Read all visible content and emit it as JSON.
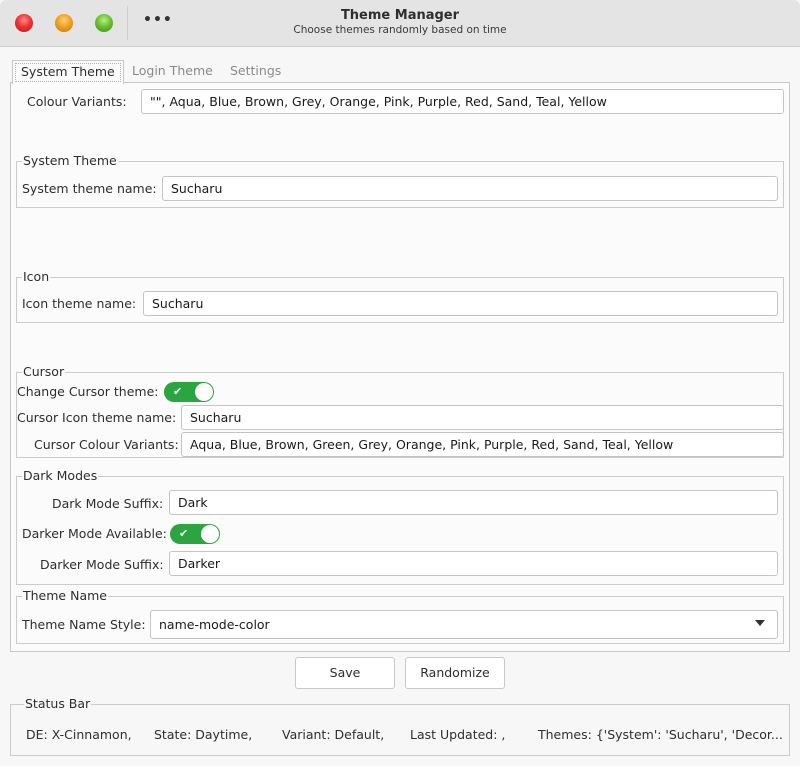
{
  "window": {
    "title": "Theme Manager",
    "subtitle": "Choose themes randomly based on time",
    "more_label": "•••"
  },
  "tabs": [
    {
      "label": "System Theme",
      "active": true
    },
    {
      "label": "Login Theme",
      "active": false
    },
    {
      "label": "Settings",
      "active": false
    }
  ],
  "colour_variants": {
    "label": "Colour Variants:",
    "value": "\"\", Aqua, Blue, Brown, Grey, Orange, Pink, Purple, Red, Sand, Teal, Yellow"
  },
  "system_theme": {
    "group_title": "System Theme",
    "name_label": "System theme name:",
    "name_value": "Sucharu"
  },
  "icon": {
    "group_title": "Icon",
    "name_label": "Icon theme name:",
    "name_value": "Sucharu"
  },
  "cursor": {
    "group_title": "Cursor",
    "change_label": "Change Cursor theme:",
    "change_enabled": true,
    "icon_label": "Cursor Icon theme name:",
    "icon_value": "Sucharu",
    "variants_label": "Cursor Colour Variants:",
    "variants_value": "Aqua, Blue, Brown, Green, Grey, Orange, Pink, Purple, Red, Sand, Teal, Yellow"
  },
  "dark_modes": {
    "group_title": "Dark Modes",
    "dark_suffix_label": "Dark Mode Suffix:",
    "dark_suffix_value": "Dark",
    "darker_available_label": "Darker Mode Available:",
    "darker_available": true,
    "darker_suffix_label": "Darker Mode Suffix:",
    "darker_suffix_value": "Darker"
  },
  "theme_name": {
    "group_title": "Theme Name",
    "style_label": "Theme Name Style:",
    "style_value": "name-mode-color"
  },
  "buttons": {
    "save": "Save",
    "randomize": "Randomize"
  },
  "status_bar": {
    "title": "Status Bar",
    "de": "DE: X-Cinnamon,",
    "state": "State: Daytime,",
    "variant": "Variant: Default,",
    "last_updated": "Last Updated: ,",
    "themes": "Themes: {'System': 'Sucharu', 'Decor..."
  },
  "colors": {
    "toggle_on": "#2aa540",
    "close": "#e33333",
    "minimize": "#f0a020",
    "maximize": "#6cc030"
  }
}
